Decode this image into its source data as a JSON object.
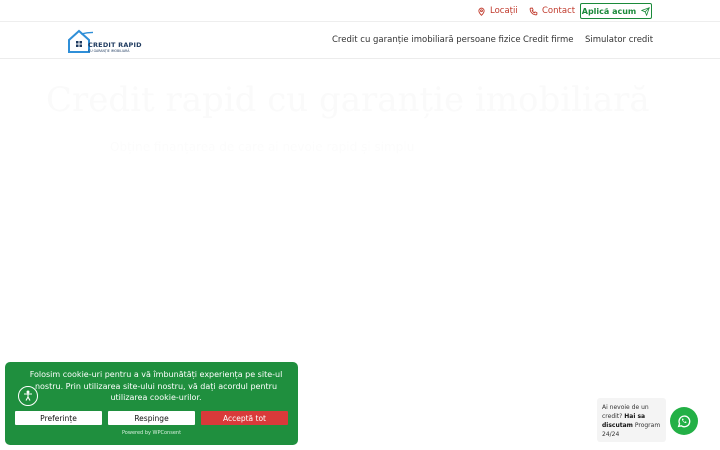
{
  "topbar": {
    "locations_label": "Locații",
    "contact_label": "Contact",
    "apply_label": "Aplică acum"
  },
  "navbar": {
    "logo_text": "CREDIT RAPID",
    "logo_subtext": "CU GARANȚIE IMOBILIARĂ",
    "links": [
      "Credit cu garanție imobiliară persoane fizice",
      "Credit firme",
      "Simulator credit"
    ]
  },
  "hero": {
    "title": "Credit rapid cu garanție imobiliară",
    "subtitle": "Obține finanțarea de care ai nevoie rapid și simplu"
  },
  "cookie_banner": {
    "message": "Folosim cookie-uri pentru a vă îmbunătăți experiența pe site-ul nostru. Prin utilizarea site-ului nostru, vă dați acordul pentru utilizarea cookie-urilor.",
    "preferences_label": "Preferințe",
    "reject_label": "Respinge",
    "accept_label": "Acceptă tot",
    "powered_by": "Powered by  WPConsent"
  },
  "whatsapp": {
    "line1": "Ai nevoie de un credit?",
    "bold": "Hai sa discutam",
    "line2": "Program 24/24"
  },
  "colors": {
    "accent_red": "#c0392b",
    "brand_green": "#1f8f3e",
    "whatsapp_green": "#23b046",
    "logo_blue": "#1e3a5f"
  }
}
